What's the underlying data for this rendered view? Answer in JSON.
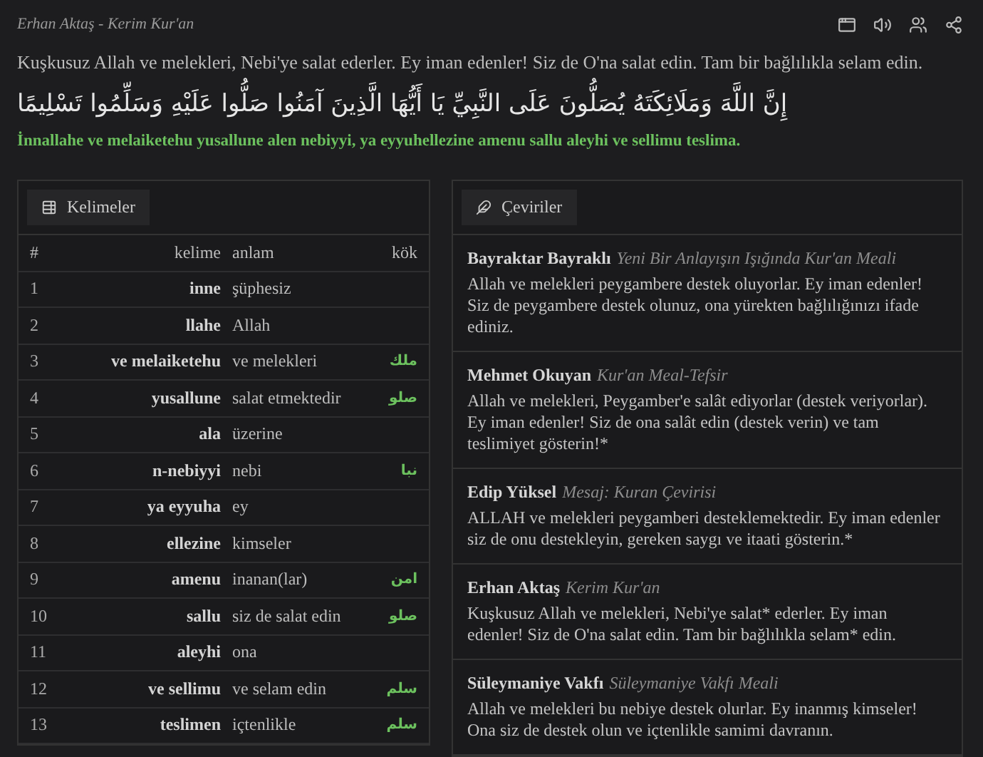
{
  "header": {
    "source": "Erhan Aktaş - Kerim Kur'an"
  },
  "verse": {
    "translation": "Kuşkusuz Allah ve melekleri, Nebi'ye salat ederler. Ey iman edenler! Siz de O'na salat edin. Tam bir bağlılıkla selam edin.",
    "arabic": "إِنَّ اللَّهَ وَمَلَائِكَتَهُ يُصَلُّونَ عَلَى النَّبِيِّ يَا أَيُّهَا الَّذِينَ آمَنُوا صَلُّوا عَلَيْهِ وَسَلِّمُوا تَسْلِيمًا",
    "transliteration": "İnnallahe ve melaiketehu yusallune alen nebiyyi, ya eyyuhellezine amenu sallu aleyhi ve sellimu teslima."
  },
  "words_panel": {
    "title": "Kelimeler",
    "columns": [
      "#",
      "kelime",
      "anlam",
      "kök"
    ],
    "rows": [
      {
        "number": "1",
        "word": "inne",
        "meaning": "şüphesiz"
      },
      {
        "number": "2",
        "word": "llahe",
        "meaning": "Allah"
      },
      {
        "number": "3",
        "word": "ve melaiketehu",
        "meaning": "ve melekleri",
        "root": "ملك"
      },
      {
        "number": "4",
        "word": "yusallune",
        "meaning": "salat etmektedir",
        "root": "صلو"
      },
      {
        "number": "5",
        "word": "ala",
        "meaning": "üzerine"
      },
      {
        "number": "6",
        "word": "n-nebiyyi",
        "meaning": "nebi",
        "root": "نبا"
      },
      {
        "number": "7",
        "word": "ya eyyuha",
        "meaning": "ey"
      },
      {
        "number": "8",
        "word": "ellezine",
        "meaning": "kimseler"
      },
      {
        "number": "9",
        "word": "amenu",
        "meaning": "inanan(lar)",
        "root": "امن"
      },
      {
        "number": "10",
        "word": "sallu",
        "meaning": "siz de salat edin",
        "root": "صلو"
      },
      {
        "number": "11",
        "word": "aleyhi",
        "meaning": "ona"
      },
      {
        "number": "12",
        "word": "ve sellimu",
        "meaning": "ve selam edin",
        "root": "سلم"
      },
      {
        "number": "13",
        "word": "teslimen",
        "meaning": "içtenlikle",
        "root": "سلم"
      }
    ]
  },
  "translations_panel": {
    "title": "Çeviriler",
    "items": [
      {
        "author": "Bayraktar Bayraklı",
        "book": "Yeni Bir Anlayışın Işığında Kur'an Meali",
        "text": "Allah ve melekleri peygambere destek oluyorlar. Ey iman edenler! Siz de peygambere destek olunuz, ona yürekten bağlılığınızı ifade ediniz."
      },
      {
        "author": "Mehmet Okuyan",
        "book": "Kur'an Meal-Tefsir",
        "text": "Allah ve melekleri, Peygamber'e salât ediyorlar (destek veriyorlar). Ey iman edenler! Siz de ona salât edin (destek verin) ve tam teslimiyet gösterin!*"
      },
      {
        "author": "Edip Yüksel",
        "book": "Mesaj: Kuran Çevirisi",
        "text": "ALLAH ve melekleri peygamberi desteklemektedir. Ey iman edenler siz de onu destekleyin, gereken saygı ve itaati gösterin.*"
      },
      {
        "author": "Erhan Aktaş",
        "book": "Kerim Kur'an",
        "text": "Kuşkusuz Allah ve melekleri, Nebi'ye salat* ederler. Ey iman edenler! Siz de O'na salat edin. Tam bir bağlılıkla selam* edin."
      },
      {
        "author": "Süleymaniye Vakfı",
        "book": "Süleymaniye Vakfı Meali",
        "text": "Allah ve melekleri bu nebiye destek olurlar. Ey inanmış kimseler! Ona siz de destek olun ve içtenlikle samimi davranın."
      }
    ]
  }
}
